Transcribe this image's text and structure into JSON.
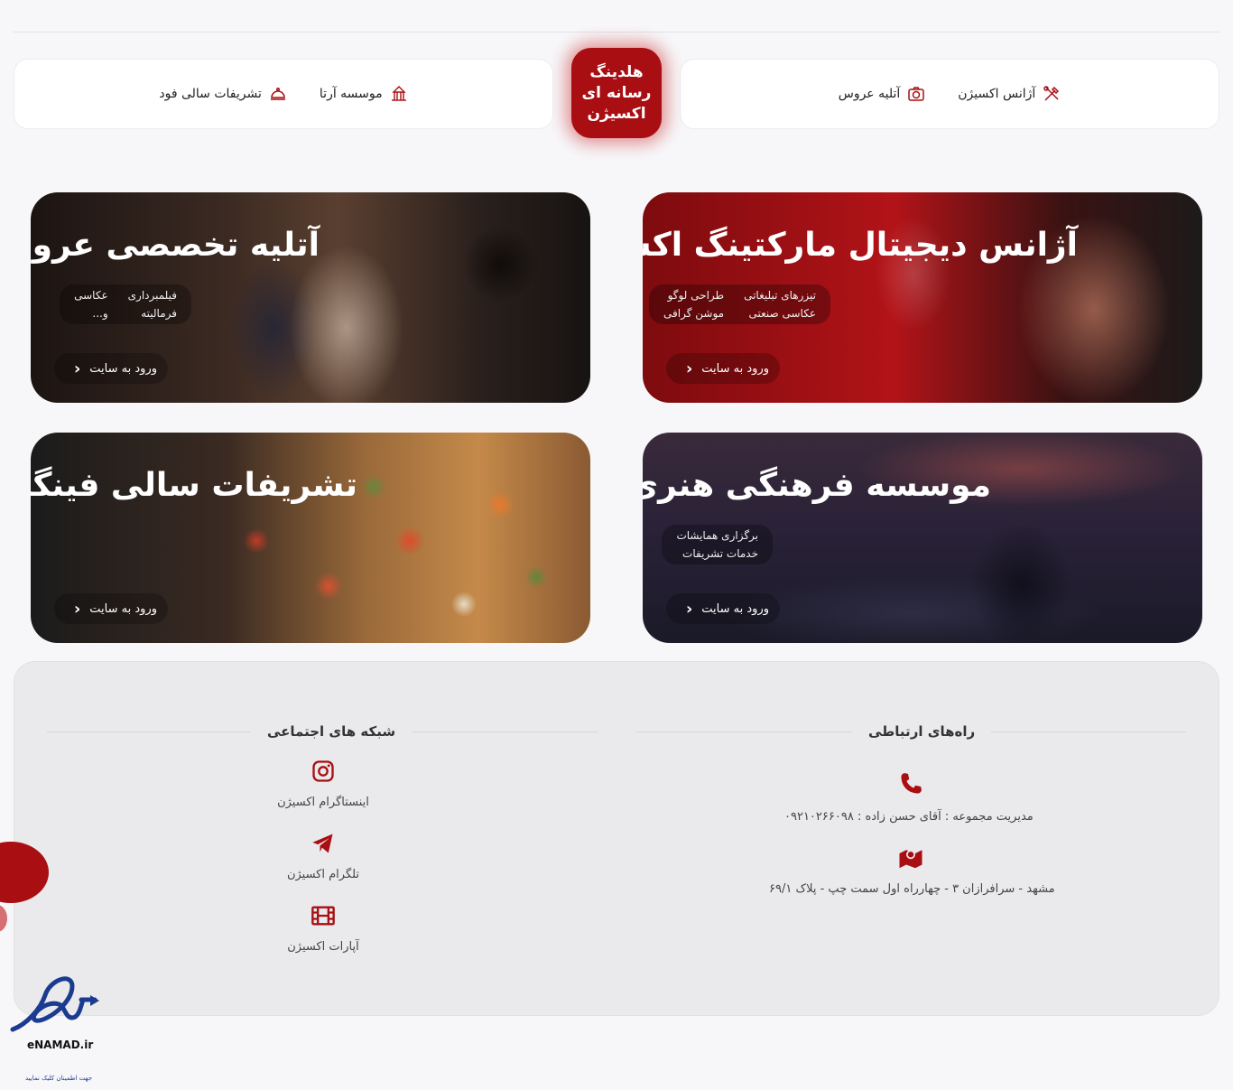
{
  "logo": {
    "line1": "هلدینگ",
    "line2": "رسانه ای",
    "line3": "اکسیژن"
  },
  "nav_right": [
    {
      "label": "آژانس اکسیژن",
      "icon": "tools-icon"
    },
    {
      "label": "آتلیه عروس",
      "icon": "camera-icon"
    }
  ],
  "nav_left": [
    {
      "label": "موسسه آرتا",
      "icon": "theater-icon"
    },
    {
      "label": "تشریفات سالی فود",
      "icon": "food-tray-icon"
    }
  ],
  "cards": {
    "agency": {
      "title": "آژانس دیجیتال مارکتینگ اکسیژن",
      "tags": [
        "تیزرهای تبلیغاتی",
        "طراحی لوگو",
        "عکاسی صنعتی",
        "موشن گرافی"
      ],
      "enter": "ورود به سایت"
    },
    "atelier": {
      "title": "آتلیه تخصصی عروس",
      "tags": [
        "فیلمبرداری",
        "عکاسی",
        "فرمالیته",
        "و..."
      ],
      "enter": "ورود به سایت"
    },
    "arta": {
      "title": "موسسه فرهنگی هنری آرتا",
      "tags": [
        "برگزاری همایشات",
        "خدمات تشریفات"
      ],
      "enter": "ورود به سایت"
    },
    "food": {
      "title": "تشریفات سالی فینگرفود",
      "enter": "ورود به سایت"
    }
  },
  "footer": {
    "contact_title": "راه‌های ارتباطی",
    "manager": "مدیریت مجموعه : آقای حسن زاده : ۰۹۲۱۰۲۶۶۰۹۸",
    "address": "مشهد - سرافرازان ۳ - چهارراه اول سمت چپ - پلاک ۶۹/۱",
    "social_title": "شبکه های اجتماعی",
    "instagram": "اینستاگرام اکسیژن",
    "telegram": "تلگرام اکسیژن",
    "aparat": "آپارات اکسیژن"
  },
  "enamad": {
    "brand": "eNAMAD.ir",
    "caption": "جهت اطمینان کلیک نمایید"
  },
  "colors": {
    "brand_red": "#a80e12"
  }
}
